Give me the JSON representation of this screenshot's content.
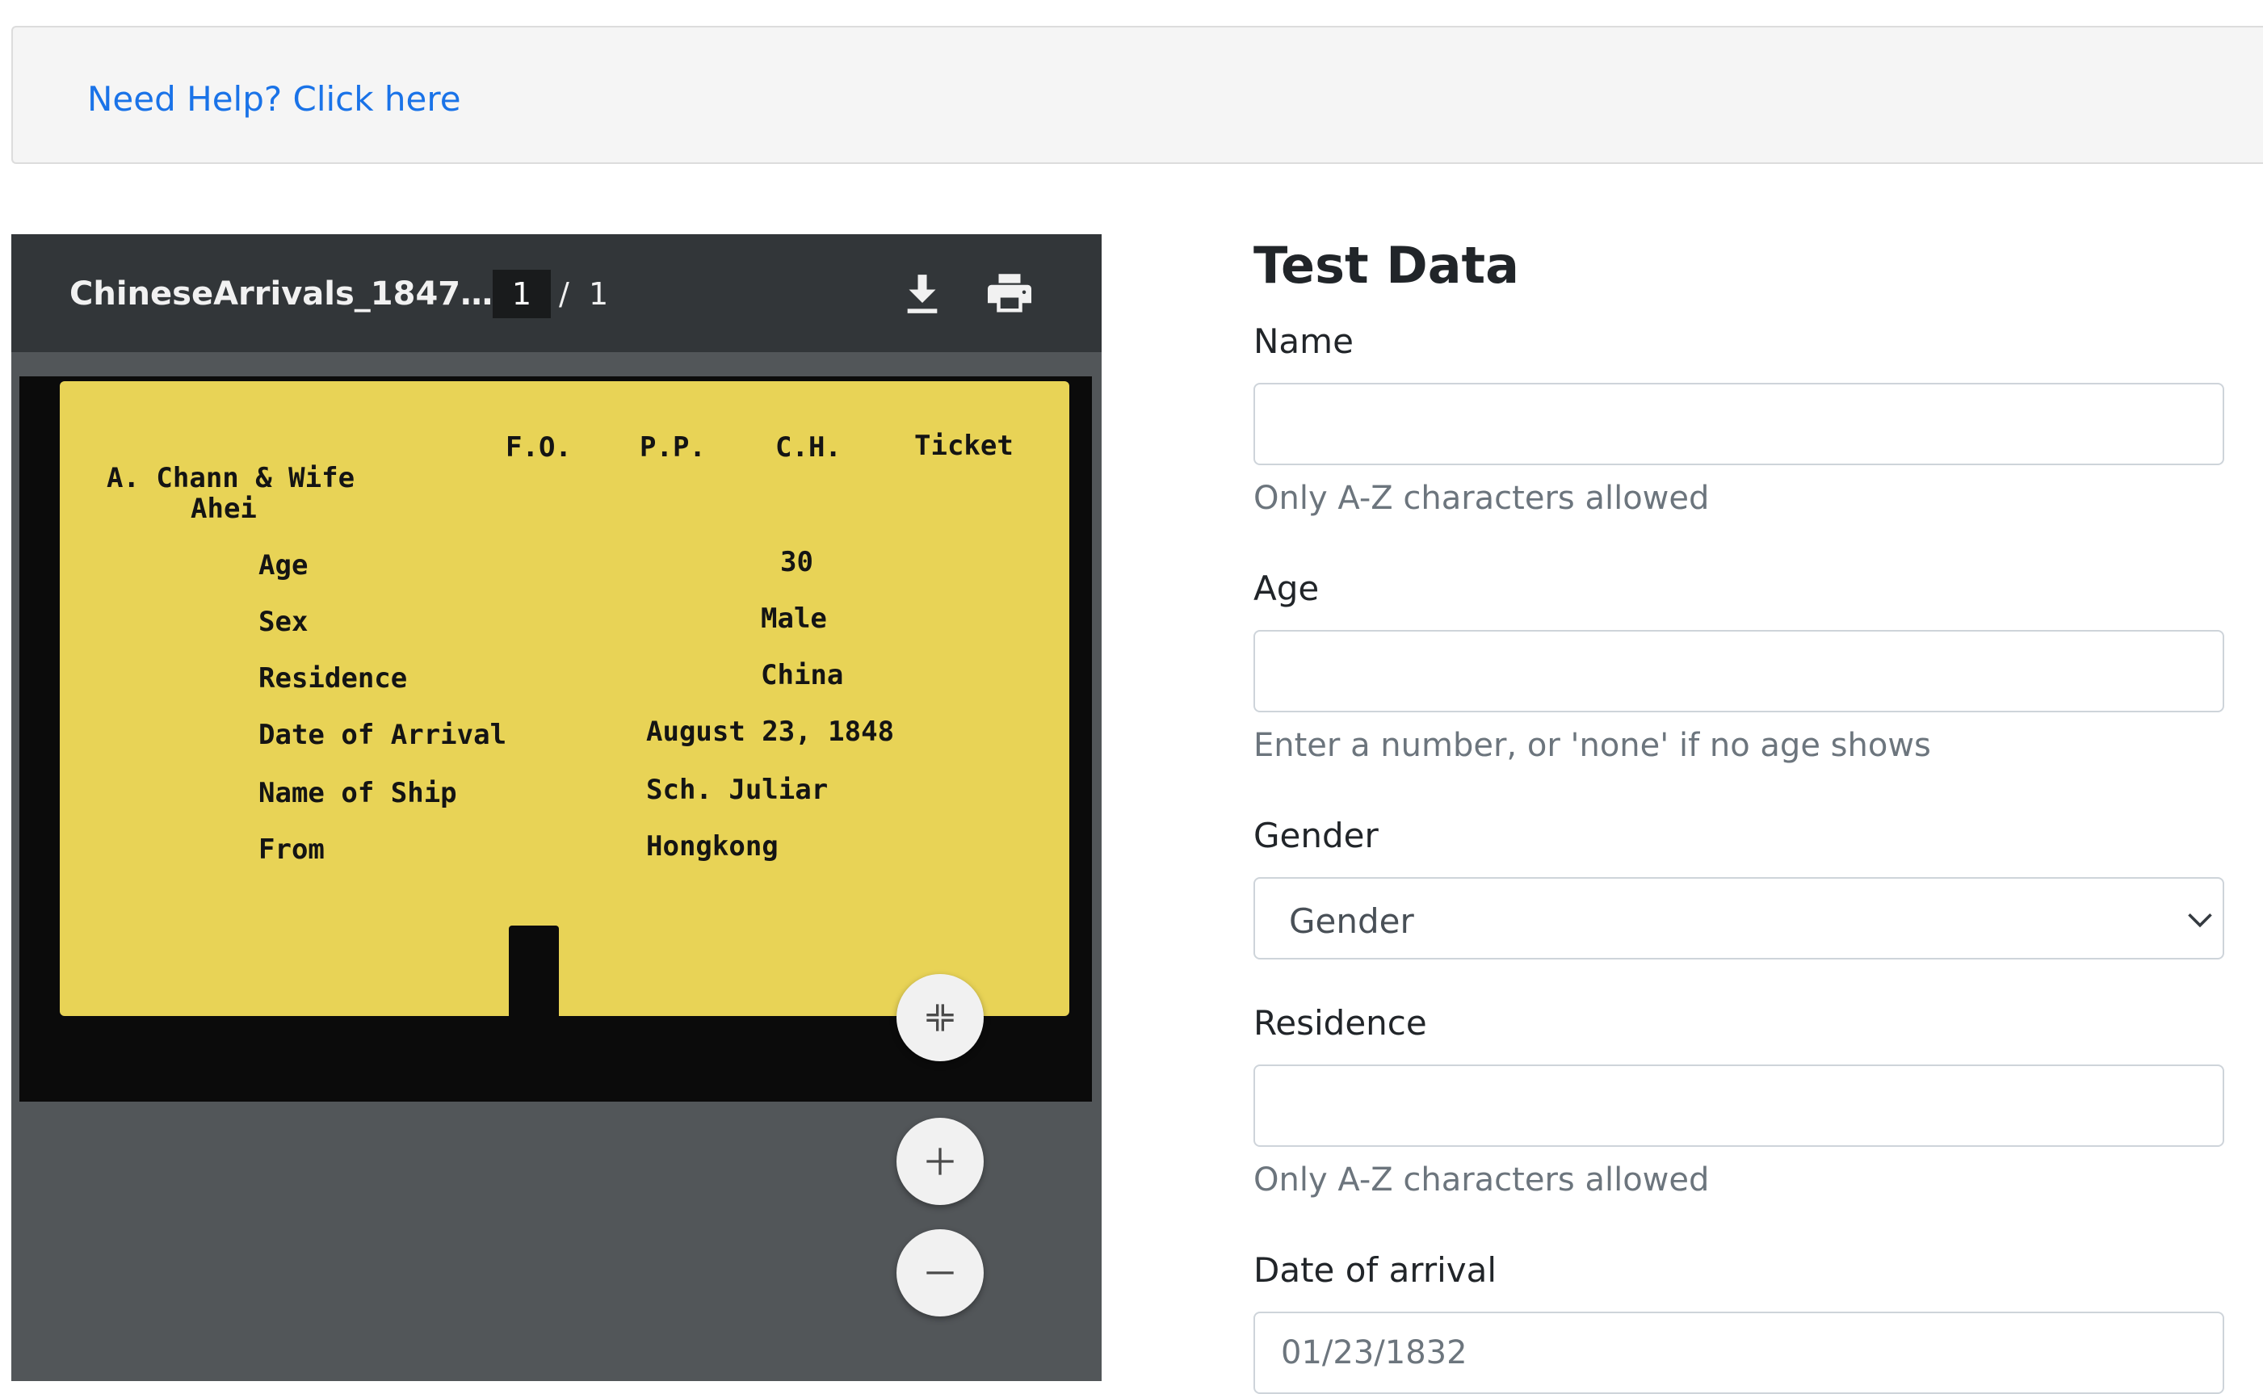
{
  "help": {
    "link_text": "Need Help? Click here"
  },
  "viewer": {
    "doc_title": "ChineseArrivals_1847-187…",
    "current_page": "1",
    "page_separator": "/",
    "total_pages": "1",
    "icons": {
      "download": "download-icon",
      "print": "print-icon",
      "fit": "fit-to-page-icon",
      "zoom_in": "plus-icon",
      "zoom_out": "minus-icon"
    },
    "colors": {
      "toolbar": "#323639",
      "background": "#525659",
      "card": "#e8d356"
    }
  },
  "card": {
    "headers": {
      "fo": "F.O.",
      "pp": "P.P.",
      "ch": "C.H.",
      "ticket": "Ticket"
    },
    "name_line1": "A. Chann & Wife",
    "name_line2": "Ahei",
    "fields": {
      "age_label": "Age",
      "age_value": "30",
      "sex_label": "Sex",
      "sex_value": "Male",
      "residence_label": "Residence",
      "residence_value": "China",
      "arrival_label": "Date of Arrival",
      "arrival_value": "August 23, 1848",
      "ship_label": "Name of Ship",
      "ship_value": "Sch. Juliar",
      "from_label": "From",
      "from_value": "Hongkong"
    }
  },
  "form": {
    "title": "Test Data",
    "name": {
      "label": "Name",
      "value": "",
      "hint": "Only A-Z characters allowed"
    },
    "age": {
      "label": "Age",
      "value": "",
      "hint": "Enter a number, or 'none' if no age shows"
    },
    "gender": {
      "label": "Gender",
      "selected": "Gender"
    },
    "residence": {
      "label": "Residence",
      "value": "",
      "hint": "Only A-Z characters allowed"
    },
    "arrival": {
      "label": "Date of arrival",
      "placeholder": "01/23/1832"
    }
  }
}
